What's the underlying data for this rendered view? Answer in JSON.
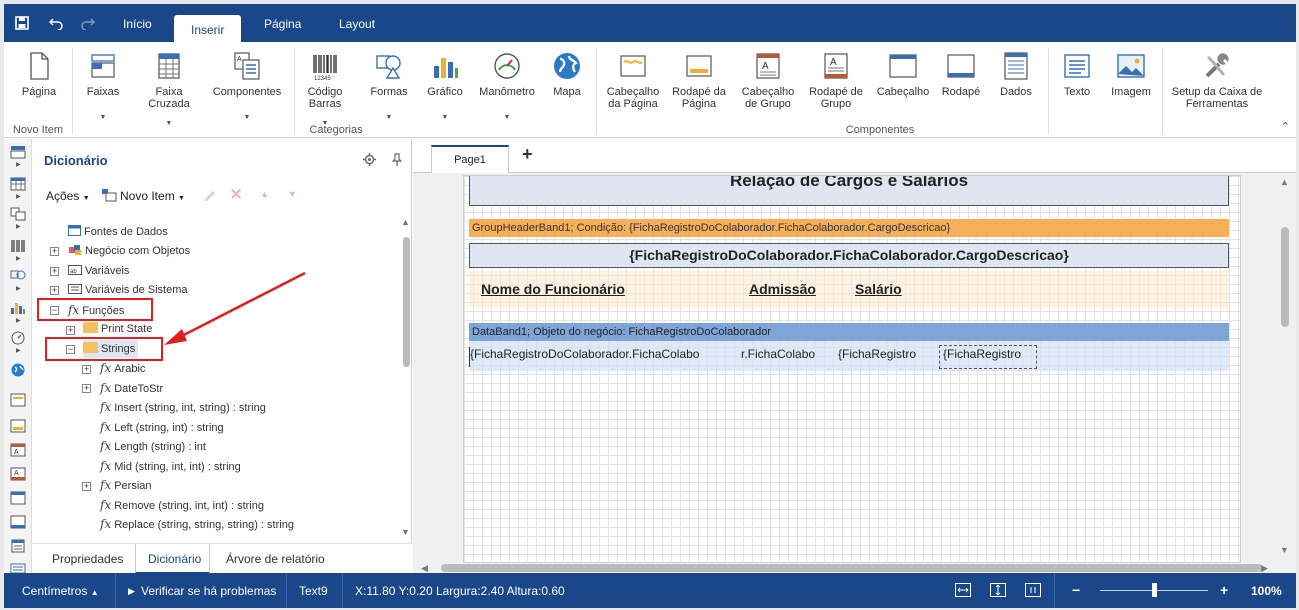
{
  "menubar": {
    "tabs": [
      "Início",
      "Inserir",
      "Página",
      "Layout"
    ],
    "active": "Inserir"
  },
  "ribbon": {
    "items": [
      {
        "label": "Página",
        "icon": "page-icon"
      },
      {
        "label": "Faixas",
        "icon": "bands-icon",
        "dropdown": true
      },
      {
        "label": "Faixa Cruzada",
        "icon": "cross-band-icon",
        "dropdown": true
      },
      {
        "label": "Componentes",
        "icon": "components-icon",
        "dropdown": true
      },
      {
        "label": "Código Barras",
        "icon": "barcode-icon",
        "dropdown": true
      },
      {
        "label": "Formas",
        "icon": "shapes-icon",
        "dropdown": true
      },
      {
        "label": "Gráfico",
        "icon": "chart-icon",
        "dropdown": true
      },
      {
        "label": "Manômetro",
        "icon": "gauge-icon",
        "dropdown": true
      },
      {
        "label": "Mapa",
        "icon": "map-icon"
      },
      {
        "label": "Cabeçalho da Página",
        "icon": "page-header-icon"
      },
      {
        "label": "Rodapé da Página",
        "icon": "page-footer-icon"
      },
      {
        "label": "Cabeçalho de Grupo",
        "icon": "group-header-icon"
      },
      {
        "label": "Rodapé de Grupo",
        "icon": "group-footer-icon"
      },
      {
        "label": "Cabeçalho",
        "icon": "header-icon"
      },
      {
        "label": "Rodapé",
        "icon": "footer-icon"
      },
      {
        "label": "Dados",
        "icon": "data-icon"
      },
      {
        "label": "Texto",
        "icon": "text-icon"
      },
      {
        "label": "Imagem",
        "icon": "image-icon"
      },
      {
        "label": "Setup da Caixa de Ferramentas",
        "icon": "tools-icon"
      }
    ],
    "groups": {
      "novo_item": "Novo Item",
      "categorias": "Categorias",
      "componentes": "Componentes"
    }
  },
  "dictionary": {
    "title": "Dicionário",
    "actions": "Ações",
    "new_item": "Novo Item",
    "tree": [
      {
        "label": "Fontes de Dados"
      },
      {
        "label": "Negócio com Objetos"
      },
      {
        "label": "Variáveis"
      },
      {
        "label": "Variáveis de Sistema"
      },
      {
        "label": "Funções"
      },
      {
        "label": "Print State"
      },
      {
        "label": "Strings"
      },
      {
        "label": "Arabic"
      },
      {
        "label": "DateToStr"
      },
      {
        "label": "Insert (string, int, string) : string"
      },
      {
        "label": "Left (string, int) : string"
      },
      {
        "label": "Length (string) : int"
      },
      {
        "label": "Mid (string, int, int) : string"
      },
      {
        "label": "Persian"
      },
      {
        "label": "Remove (string, int, int) : string"
      },
      {
        "label": "Replace (string, string, string) : string"
      }
    ],
    "bottom_tabs": [
      "Propriedades",
      "Dicionário",
      "Árvore de relatório"
    ],
    "active_bottom_tab": "Dicionário"
  },
  "designer": {
    "page_tab": "Page1",
    "add_page": "+",
    "title_text": "Relação de Cargos e Salários",
    "group_header_band": "GroupHeaderBand1; Condição: {FichaRegistroDoColaborador.FichaColaborador.CargoDescricao}",
    "group_header_field": "{FichaRegistroDoColaborador.FichaColaborador.CargoDescricao}",
    "col_nome": "Nome do Funcionário",
    "col_admissao": "Admissão",
    "col_salario": "Salário",
    "data_band": "DataBand1; Objeto do negócio: FichaRegistroDoColaborador",
    "data_fields": [
      "{FichaRegistroDoColaborador.FichaColabo",
      "r.FichaColabo",
      "{FichaRegistro",
      "{FichaRegistro"
    ]
  },
  "status": {
    "units": "Centímetros",
    "check": "Verificar se há problemas",
    "component": "Text9",
    "coords": "X:11.80 Y:0.20 Largura:2.40 Altura:0.60",
    "zoom": "100%",
    "zoom_level": 0.5
  },
  "colors": {
    "brand": "#19478a",
    "group_band": "#f7b05a",
    "data_band": "#7ea5d8",
    "highlight": "#e02020"
  }
}
